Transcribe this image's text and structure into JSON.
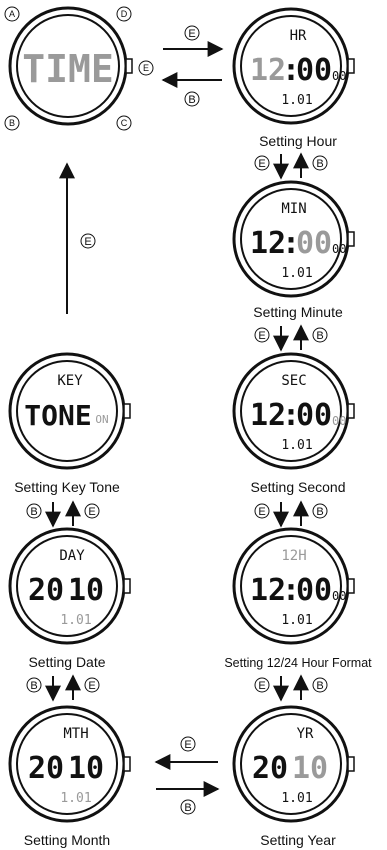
{
  "buttons": {
    "a": "A",
    "b": "B",
    "c": "C",
    "d": "D",
    "e": "E"
  },
  "screens": {
    "time": {
      "main": "TIME"
    },
    "hour": {
      "top": "HR",
      "hh": "12",
      "mm": "00",
      "ss": "00",
      "date": "1.01",
      "caption": "Setting Hour"
    },
    "minute": {
      "top": "MIN",
      "hh": "12",
      "mm": "00",
      "ss": "00",
      "date": "1.01",
      "caption": "Setting Minute"
    },
    "second": {
      "top": "SEC",
      "hh": "12",
      "mm": "00",
      "ss": "00",
      "date": "1.01",
      "caption": "Setting Second"
    },
    "format": {
      "top": "12H",
      "hh": "12",
      "mm": "00",
      "ss": "00",
      "date": "1.01",
      "caption": "Setting 12/24 Hour Format"
    },
    "year": {
      "top": "YR",
      "yl": "20",
      "yr": "10",
      "date": "1.01",
      "caption": "Setting Year"
    },
    "month": {
      "top": "MTH",
      "yl": "20",
      "yr": "10",
      "date": "1.01",
      "caption": "Setting Month"
    },
    "date": {
      "top": "DAY",
      "yl": "20",
      "yr": "10",
      "date": "1.01",
      "caption": "Setting Date"
    },
    "keytone": {
      "top": "KEY",
      "main": "TONE",
      "state": "ON",
      "caption": "Setting Key Tone"
    }
  },
  "arrows": {
    "time_to_hour": "E",
    "hour_to_time": "B",
    "hour_minute_down": "E",
    "hour_minute_up": "B",
    "minute_second_down": "E",
    "minute_second_up": "B",
    "second_format_down": "E",
    "second_format_up": "B",
    "format_year_down": "E",
    "format_year_up": "B",
    "year_to_month": "E",
    "month_to_year": "B",
    "month_date_down": "B",
    "month_date_up": "E",
    "date_key_down": "B",
    "date_key_up": "E",
    "key_to_time": "E"
  }
}
